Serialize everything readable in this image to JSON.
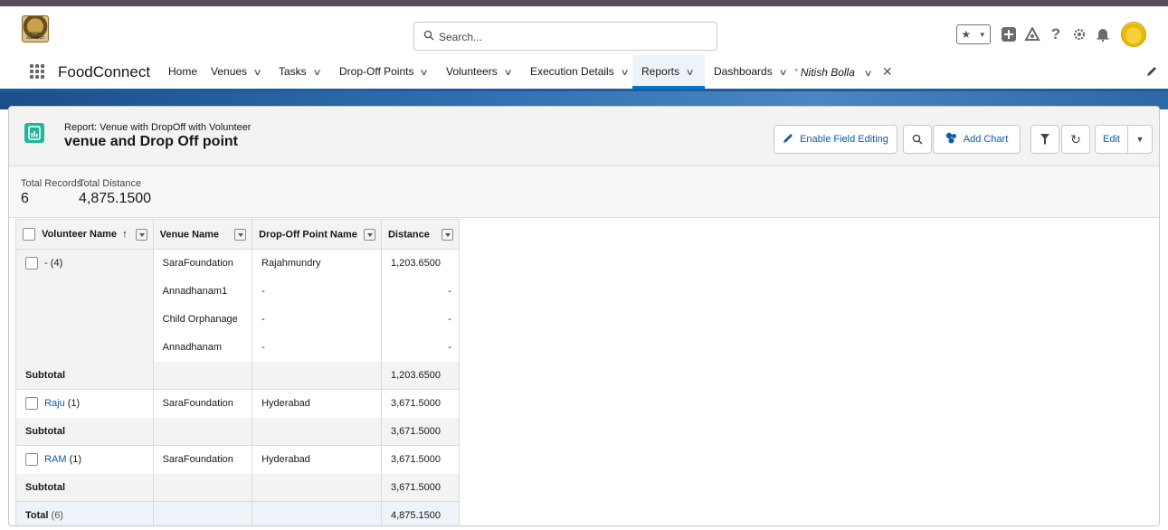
{
  "header": {
    "logo_text": "FOOD CONNECT",
    "search_placeholder": "Search..."
  },
  "nav": {
    "app_name": "FoodConnect",
    "items": [
      {
        "label": "Home",
        "has_menu": false
      },
      {
        "label": "Venues",
        "has_menu": true
      },
      {
        "label": "Tasks",
        "has_menu": true
      },
      {
        "label": "Drop-Off Points",
        "has_menu": true
      },
      {
        "label": "Volunteers",
        "has_menu": true
      },
      {
        "label": "Execution Details",
        "has_menu": true
      },
      {
        "label": "Reports",
        "has_menu": true,
        "active": true
      },
      {
        "label": "Dashboards",
        "has_menu": true
      }
    ],
    "user_tab": "Nitish Bolla",
    "user_tab_marker": "*"
  },
  "report": {
    "subtitle": "Report: Venue with DropOff with Volunteer",
    "title": "venue and Drop Off point",
    "buttons": {
      "enable_field_editing": "Enable Field Editing",
      "add_chart": "Add Chart",
      "edit": "Edit"
    },
    "stats": {
      "total_records_label": "Total Records",
      "total_records_value": "6",
      "total_distance_label": "Total Distance",
      "total_distance_value": "4,875.1500"
    },
    "columns": {
      "volunteer": "Volunteer Name",
      "sort_arrow": "↑",
      "venue": "Venue Name",
      "dropoff": "Drop-Off Point Name",
      "distance": "Distance"
    },
    "groups": [
      {
        "label": "-",
        "count": "(4)",
        "rows": [
          {
            "venue": "SaraFoundation",
            "dropoff": "Rajahmundry",
            "distance": "1,203.6500"
          },
          {
            "venue": "Annadhanam1",
            "dropoff": "-",
            "distance": "-"
          },
          {
            "venue": "Child Orphanage",
            "dropoff": "-",
            "distance": "-"
          },
          {
            "venue": "Annadhanam",
            "dropoff": "-",
            "distance": "-"
          }
        ],
        "subtotal_label": "Subtotal",
        "subtotal": "1,203.6500"
      },
      {
        "label": "Raju",
        "count": "(1)",
        "rows": [
          {
            "venue": "SaraFoundation",
            "dropoff": "Hyderabad",
            "distance": "3,671.5000"
          }
        ],
        "subtotal_label": "Subtotal",
        "subtotal": "3,671.5000"
      },
      {
        "label": "RAM",
        "count": "(1)",
        "rows": [
          {
            "venue": "SaraFoundation",
            "dropoff": "Hyderabad",
            "distance": "3,671.5000"
          }
        ],
        "subtotal_label": "Subtotal",
        "subtotal": "3,671.5000"
      }
    ],
    "total_label": "Total",
    "total_count": "(6)",
    "total_value": "4,875.1500"
  }
}
